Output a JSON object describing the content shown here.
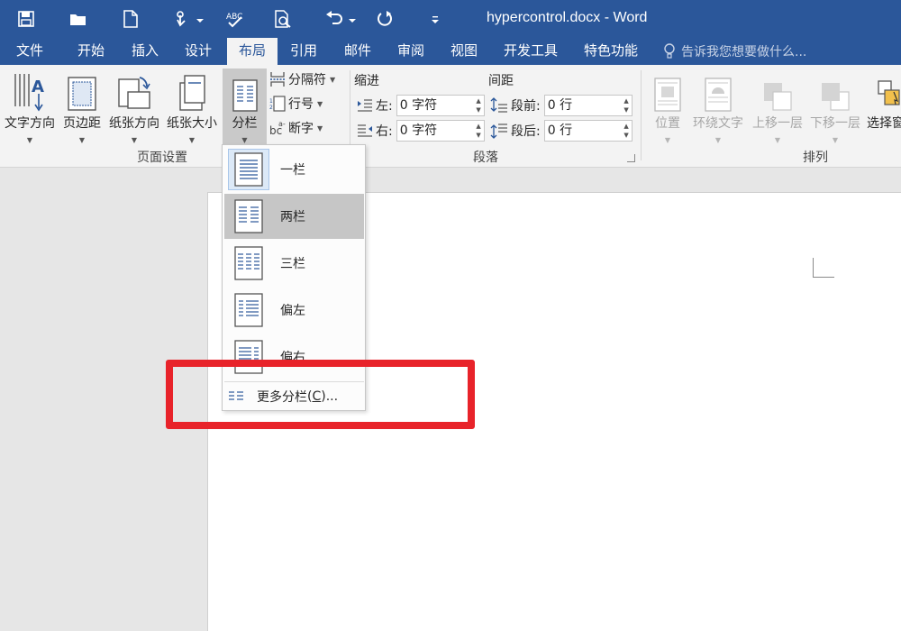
{
  "window": {
    "title": "hypercontrol.docx - Word"
  },
  "quick_access": [
    "save-icon",
    "open-icon",
    "new-icon",
    "touch-mode-icon",
    "spelling-icon",
    "print-preview-icon",
    "undo-icon",
    "redo-icon",
    "customize-icon"
  ],
  "tabs": [
    {
      "label": "文件",
      "active": false
    },
    {
      "label": "开始",
      "active": false
    },
    {
      "label": "插入",
      "active": false
    },
    {
      "label": "设计",
      "active": false
    },
    {
      "label": "布局",
      "active": true
    },
    {
      "label": "引用",
      "active": false
    },
    {
      "label": "邮件",
      "active": false
    },
    {
      "label": "审阅",
      "active": false
    },
    {
      "label": "视图",
      "active": false
    },
    {
      "label": "开发工具",
      "active": false
    },
    {
      "label": "特色功能",
      "active": false
    }
  ],
  "tell_me": {
    "placeholder": "告诉我您想要做什么..."
  },
  "page_setup": {
    "label": "页面设置",
    "text_direction": "文字方向",
    "margins": "页边距",
    "orientation": "纸张方向",
    "size": "纸张大小",
    "columns": "分栏",
    "breaks": "分隔符",
    "line_numbers": "行号",
    "hyphenation": "断字"
  },
  "paragraph": {
    "label": "段落",
    "indent_title": "缩进",
    "spacing_title": "间距",
    "indent_left_label": "左:",
    "indent_left_value": "0 字符",
    "indent_right_label": "右:",
    "indent_right_value": "0 字符",
    "spacing_before_label": "段前:",
    "spacing_before_value": "0 行",
    "spacing_after_label": "段后:",
    "spacing_after_value": "0 行"
  },
  "arrange": {
    "label": "排列",
    "position": "位置",
    "wrap_text": "环绕文字",
    "bring_forward": "上移一层",
    "send_backward": "下移一层",
    "selection_pane": "选择窗"
  },
  "columns_menu": {
    "items": [
      {
        "label": "一栏"
      },
      {
        "label": "两栏"
      },
      {
        "label": "三栏"
      },
      {
        "label": "偏左"
      },
      {
        "label": "偏右"
      }
    ],
    "more_label": "更多分栏",
    "more_key": "C",
    "more_prefix": "(",
    "more_suffix": ")..."
  },
  "colors": {
    "brand": "#2b579a",
    "highlight": "#e8232a"
  }
}
